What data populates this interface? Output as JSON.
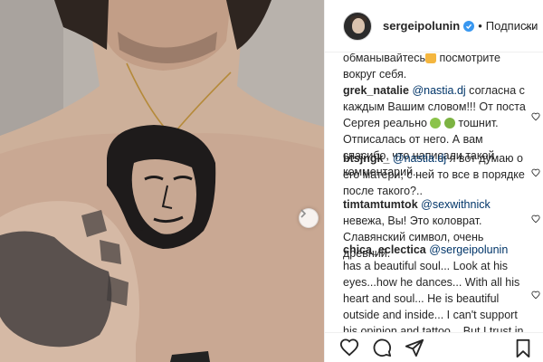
{
  "header": {
    "username": "sergeipolunin",
    "separator": "•",
    "follow_label": "Подписки",
    "more_label": "⋯"
  },
  "comments": [
    {
      "user": "",
      "segments": [
        {
          "type": "text",
          "value": "обманывайтесь"
        },
        {
          "type": "emoji",
          "value": "hand-emoji"
        },
        {
          "type": "text",
          "value": " посмотрите вокруг себя."
        }
      ]
    },
    {
      "user": "grek_natalie",
      "segments": [
        {
          "type": "mention",
          "value": "@nastia.dj"
        },
        {
          "type": "text",
          "value": " согласна с каждым Вашим словом!!! От поста Сергея реально "
        },
        {
          "type": "emoji",
          "value": "nauseated-emoji"
        },
        {
          "type": "text",
          "value": " "
        },
        {
          "type": "emoji",
          "value": "vomit-emoji"
        },
        {
          "type": "text",
          "value": " тошнит. Отписалась от него. А вам спасибо, что написали такой комментарий."
        }
      ]
    },
    {
      "user": "btsjngk_",
      "segments": [
        {
          "type": "mention",
          "value": "@nastia.dj"
        },
        {
          "type": "text",
          "value": " я вот думаю о его матери, с ней то все в порядке после такого?.."
        }
      ]
    },
    {
      "user": "timtamtumtok",
      "segments": [
        {
          "type": "mention",
          "value": "@sexwithnick"
        },
        {
          "type": "text",
          "value": " невежа, Вы! Это коловрат. Славянский символ, очень древний."
        }
      ]
    },
    {
      "user": "chica_eclectica",
      "segments": [
        {
          "type": "mention",
          "value": "@sergeipolunin"
        },
        {
          "type": "text",
          "value": " has a beautiful soul... Look at his eyes...how he dances... With all his heart and soul... He is beautiful outside and inside... I can't support his opinion and tattoo... But I trust in his light, soul and heart more than in his mind or"
        }
      ]
    }
  ],
  "icons": {
    "like": "heart-icon",
    "comment": "comment-icon",
    "share": "share-icon",
    "save": "bookmark-icon",
    "next": "chevron-right-icon",
    "verified": "verified-badge-icon"
  },
  "colors": {
    "verified": "#3897f0",
    "mention": "#003569",
    "text": "#262626",
    "border": "#efefef"
  }
}
